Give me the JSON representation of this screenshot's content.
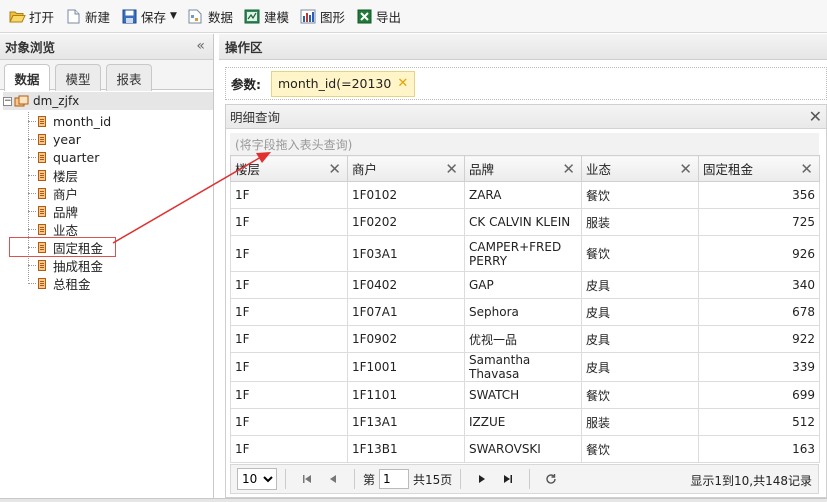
{
  "toolbar": {
    "open": "打开",
    "new": "新建",
    "save": "保存",
    "data": "数据",
    "model": "建模",
    "graph": "图形",
    "export": "导出"
  },
  "left_panel": {
    "title": "对象浏览",
    "collapse_glyph": "«",
    "tabs": [
      "数据",
      "模型",
      "报表"
    ],
    "root": "dm_zjfx",
    "fields": [
      "month_id",
      "year",
      "quarter",
      "楼层",
      "商户",
      "品牌",
      "业态",
      "固定租金",
      "抽成租金",
      "总租金"
    ]
  },
  "right_panel": {
    "title": "操作区",
    "params_label": "参数:",
    "param_chip": "month_id(=20130",
    "detail_title": "明细查询",
    "drop_hint": "(将字段拖入表头查询)",
    "columns": [
      "楼层",
      "商户",
      "品牌",
      "业态",
      "固定租金"
    ],
    "rows": [
      [
        "1F",
        "1F0102",
        "ZARA",
        "餐饮",
        "356"
      ],
      [
        "1F",
        "1F0202",
        "CK CALVIN KLEIN",
        "服装",
        "725"
      ],
      [
        "1F",
        "1F03A1",
        "CAMPER+FRED PERRY",
        "餐饮",
        "926"
      ],
      [
        "1F",
        "1F0402",
        "GAP",
        "皮具",
        "340"
      ],
      [
        "1F",
        "1F07A1",
        "Sephora",
        "皮具",
        "678"
      ],
      [
        "1F",
        "1F0902",
        "优视一品",
        "皮具",
        "922"
      ],
      [
        "1F",
        "1F1001",
        "Samantha Thavasa",
        "皮具",
        "339"
      ],
      [
        "1F",
        "1F1101",
        "SWATCH",
        "餐饮",
        "699"
      ],
      [
        "1F",
        "1F13A1",
        "IZZUE",
        "服装",
        "512"
      ],
      [
        "1F",
        "1F13B1",
        "SWAROVSKI",
        "餐饮",
        "163"
      ]
    ],
    "pager": {
      "page_size": "10",
      "page_prefix": "第",
      "page_value": "1",
      "page_suffix": "共15页",
      "info": "显示1到10,共148记录"
    }
  },
  "colors": {
    "annotation_arrow": "#e03030",
    "chip_bg": "#fff5c8"
  }
}
